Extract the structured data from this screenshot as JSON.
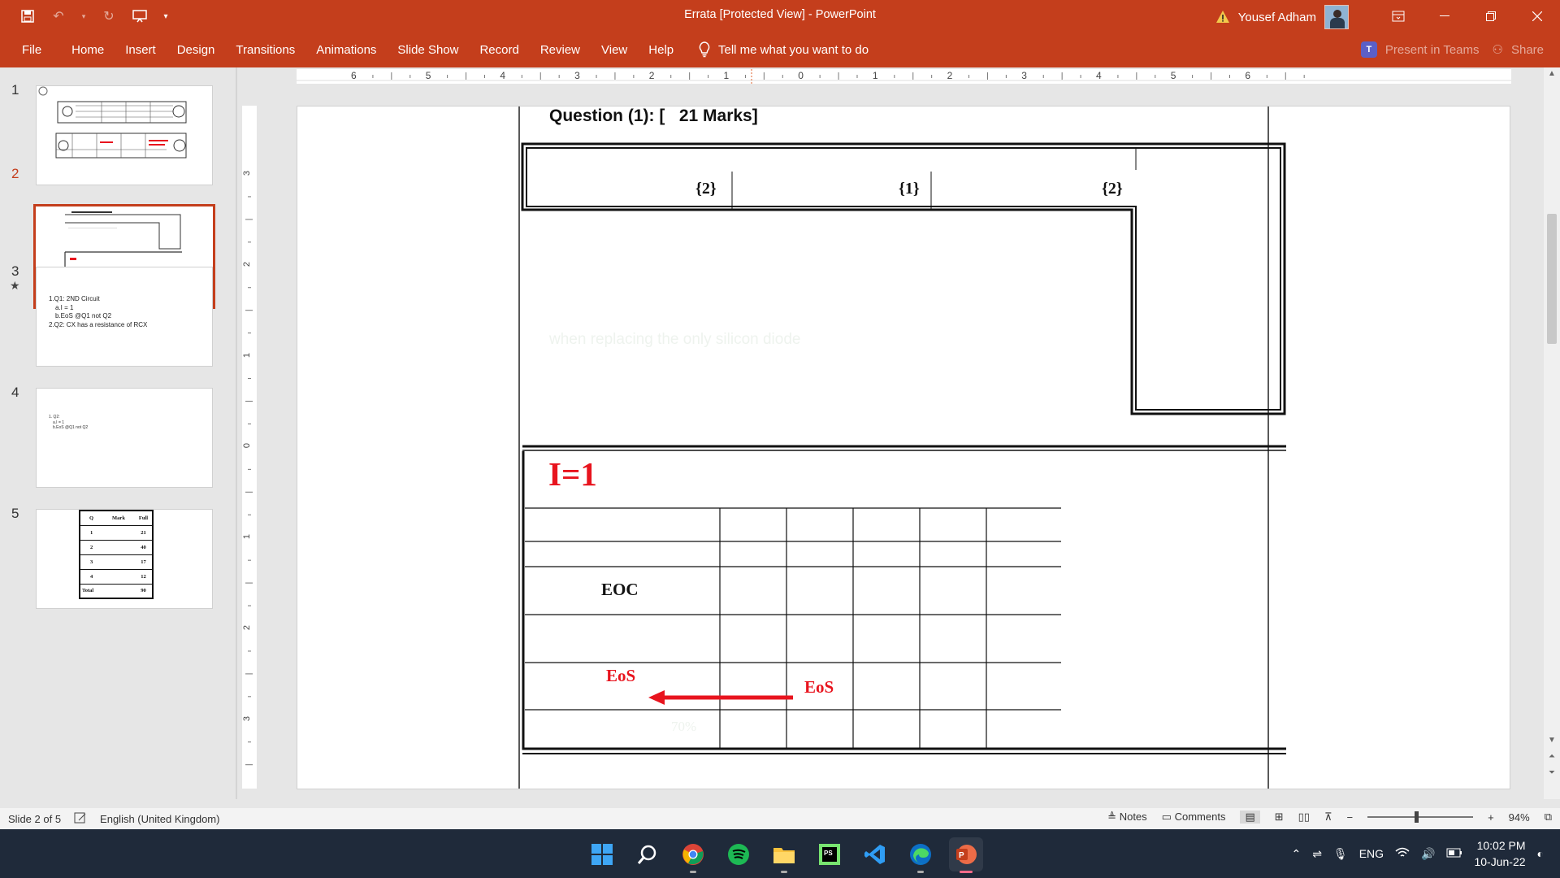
{
  "app": {
    "window_title": "Errata [Protected View]  -  PowerPoint",
    "user_name": "Yousef Adham"
  },
  "ribbon": {
    "tabs": [
      "File",
      "Home",
      "Insert",
      "Design",
      "Transitions",
      "Animations",
      "Slide Show",
      "Record",
      "Review",
      "View",
      "Help"
    ],
    "tell_me": "Tell me what you want to do",
    "present_in_teams": "Present in Teams",
    "share": "Share"
  },
  "thumbnails": [
    {
      "num": "1"
    },
    {
      "num": "2"
    },
    {
      "num": "3",
      "lines": [
        "1.Q1: 2ND Circuit",
        "a.I = 1",
        "b.EoS @Q1 not Q2",
        "2.Q2: CX has a resistance of RCX"
      ]
    },
    {
      "num": "4",
      "lines": [
        "1. Q2:",
        "a.I = 1",
        "b.EoS @Q1 not Q2"
      ]
    },
    {
      "num": "5",
      "table_header": [
        "Q",
        "Mark",
        "Full"
      ],
      "table_rows": [
        [
          "1",
          "",
          "21"
        ],
        [
          "2",
          "",
          "40"
        ],
        [
          "3",
          "",
          "17"
        ],
        [
          "4",
          "",
          "12"
        ],
        [
          "Total",
          "",
          "90"
        ]
      ]
    }
  ],
  "ruler": {
    "horizontal_labels": [
      "6",
      "5",
      "4",
      "3",
      "2",
      "1",
      "0",
      "1",
      "2",
      "3",
      "4",
      "5",
      "6"
    ],
    "vertical_labels": [
      "3",
      "2",
      "1",
      "0",
      "1",
      "2",
      "3"
    ]
  },
  "slide": {
    "question_title": "Question (1): [   21 Marks]",
    "marks": [
      "{2}",
      "{1}",
      "{2}"
    ],
    "i_equals": "I=1",
    "eoc_label": "EOC",
    "eos_left": "EoS",
    "eos_right": "EoS"
  },
  "status": {
    "slide_indicator": "Slide 2 of 5",
    "language": "English (United Kingdom)",
    "notes": "Notes",
    "comments": "Comments",
    "zoom": "94%"
  },
  "taskbar": {
    "lang": "ENG",
    "time": "10:02 PM",
    "date": "10-Jun-22"
  },
  "colors": {
    "accent": "#c43e1c",
    "red_text": "#e8141e",
    "taskbar": "#1f2a3a"
  }
}
